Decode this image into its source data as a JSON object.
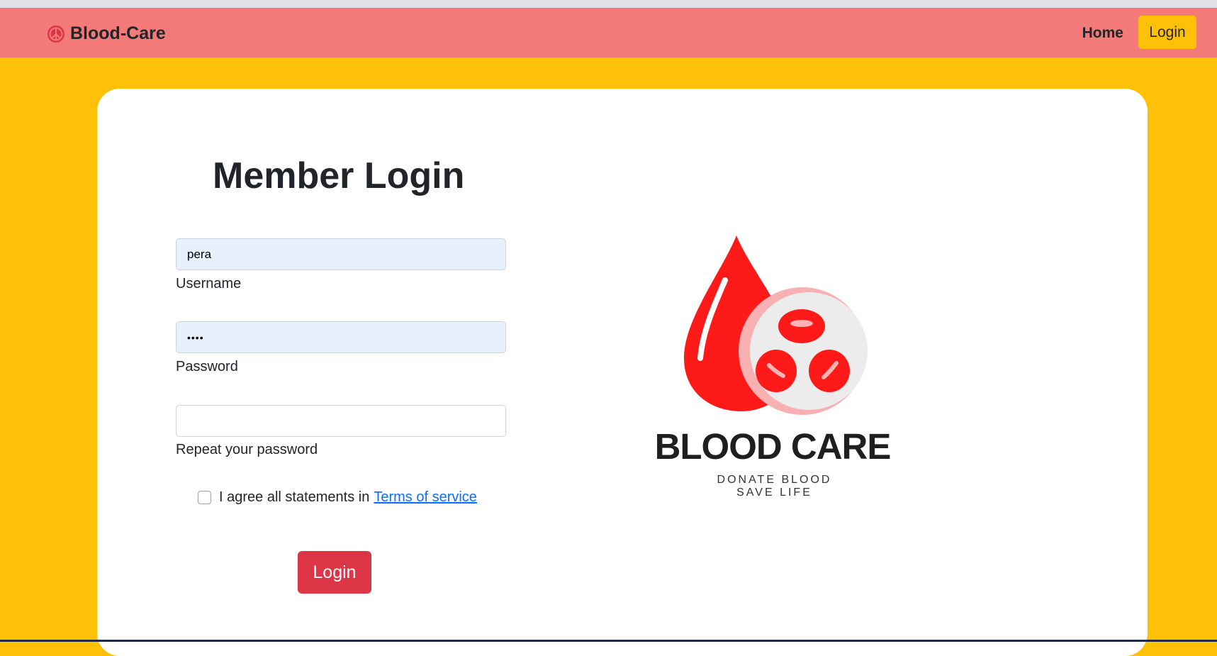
{
  "navbar": {
    "brand": "Blood-Care",
    "brand_icon": "peace-icon",
    "home_label": "Home",
    "login_label": "Login"
  },
  "form": {
    "title": "Member Login",
    "username_value": "pera",
    "username_label": "Username",
    "password_value": "••••",
    "password_label": "Password",
    "repeat_value": "",
    "repeat_label": "Repeat your password",
    "agree_text": "I agree all statements in",
    "terms_link": "Terms of service",
    "submit_label": "Login"
  },
  "logo": {
    "name": "BLOOD CARE",
    "tagline_1": "DONATE BLOOD",
    "tagline_2": "SAVE LIFE"
  },
  "colors": {
    "page_bg": "#ffc107",
    "navbar_bg": "#f47a7a",
    "accent_red": "#dc3545",
    "logo_red": "#ff1a1a"
  }
}
